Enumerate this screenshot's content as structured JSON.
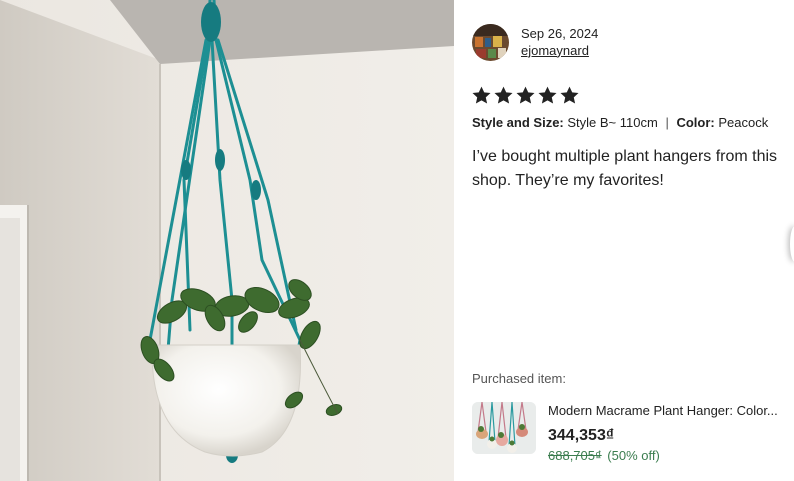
{
  "review": {
    "date": "Sep 26, 2024",
    "reviewer": "ejomaynard",
    "rating": 5,
    "style_label": "Style and Size:",
    "style_value": "Style B~ 110cm",
    "separator": "|",
    "color_label": "Color:",
    "color_value": "Peacock",
    "text": "I’ve bought multiple plant hangers from this shop. They’re my favorites!"
  },
  "purchase": {
    "label": "Purchased item:",
    "title": "Modern Macrame Plant Hanger: Color...",
    "price": "344,353₫",
    "original_price": "688,705₫",
    "discount": "(50% off)"
  },
  "icons": {
    "star": "star-icon",
    "avatar": "reviewer-avatar"
  },
  "colors": {
    "macrame": "#1d8f93",
    "discount_green": "#3b7d4f",
    "star": "#222222"
  }
}
